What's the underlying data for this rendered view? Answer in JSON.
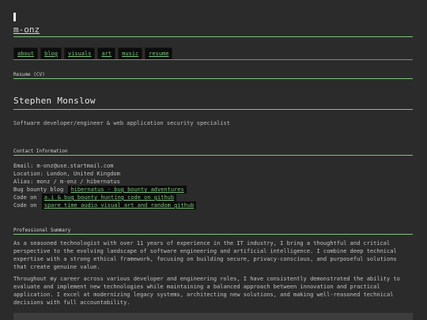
{
  "site": {
    "title": "m-onz"
  },
  "nav": [
    "about",
    "blog",
    "visuals",
    "art",
    "music",
    "resume"
  ],
  "page_label": "Resume (CV)",
  "profile": {
    "name": "Stephen Monslow",
    "tagline": "Software developer/engineer & web application security specialist"
  },
  "contact": {
    "heading": "Contact Information",
    "email": "Email: m-onz@use.startmail.com",
    "location": "Location: London, United Kingdom",
    "alias": "Alias: monz / m-onz / hibernatus",
    "blog_prefix": "Bug bounty blog",
    "blog_link": "hibernatus - bug bounty adventures",
    "code1_prefix": "Code on",
    "code1_link": "a.i & bug bounty hunting code on github",
    "code2_prefix": "Code on",
    "code2_link": "spare time audio visual art and random github"
  },
  "summary": {
    "heading": "Professional Summary",
    "p1": "As a seasoned technologist with over 11 years of experience in the IT industry, I bring a thoughtful and critical perspective to the evolving landscape of software engineering and artificial intelligence. I combine deep technical expertise with a strong ethical framework, focusing on building secure, privacy-conscious, and purposeful solutions that create genuine value.",
    "p2": "Throughout my career across various developer and engineering roles, I have consistently demonstrated the ability to evaluate and implement new technologies while maintaining a balanced approach between innovation and practical application. I excel at modernizing legacy systems, architecting new solutions, and making well-reasoned technical decisions with full accountability."
  },
  "colors": {
    "background": "#2b2b2b",
    "accent": "#7ec27e",
    "link_bg": "#0c0c0c"
  }
}
